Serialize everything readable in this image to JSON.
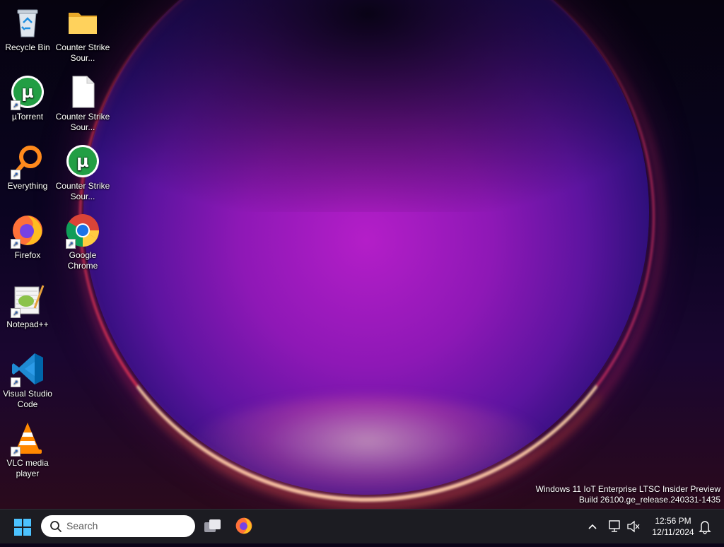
{
  "desktop": {
    "icons": [
      {
        "label": "Recycle Bin",
        "icon": "recycle-bin-icon"
      },
      {
        "label": "Counter Strike Sour...",
        "icon": "folder-icon"
      },
      {
        "label": "µTorrent",
        "icon": "utorrent-icon"
      },
      {
        "label": "Counter Strike Sour...",
        "icon": "file-icon"
      },
      {
        "label": "Everything",
        "icon": "everything-search-icon"
      },
      {
        "label": "Counter Strike Sour...",
        "icon": "utorrent-icon"
      },
      {
        "label": "Firefox",
        "icon": "firefox-icon"
      },
      {
        "label": "Google Chrome",
        "icon": "chrome-icon"
      },
      {
        "label": "Notepad++",
        "icon": "notepadpp-icon"
      },
      {
        "label": "Visual Studio Code",
        "icon": "vscode-icon"
      },
      {
        "label": "VLC media player",
        "icon": "vlc-icon"
      }
    ]
  },
  "watermark": {
    "line1": "Windows 11 IoT Enterprise LTSC Insider Preview",
    "line2": "Build 26100.ge_release.240331-1435"
  },
  "taskbar": {
    "search_placeholder": "Search",
    "clock_time": "12:56 PM",
    "clock_date": "12/11/2024"
  },
  "colors": {
    "accent": "#4cc2ff",
    "taskbar_bg": "#1c1c22"
  }
}
